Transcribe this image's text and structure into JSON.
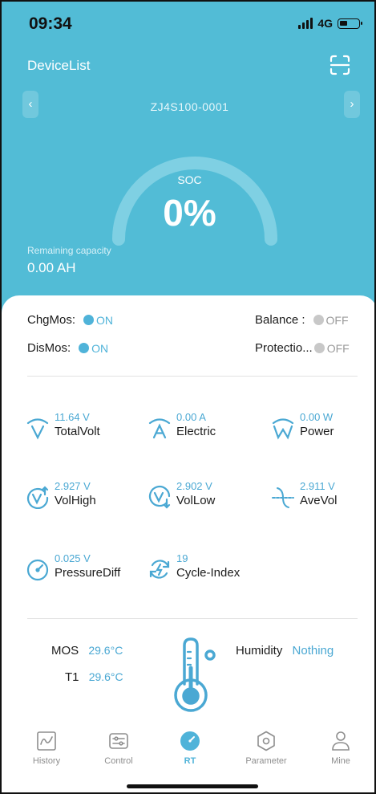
{
  "status_bar": {
    "time": "09:34",
    "network": "4G"
  },
  "header": {
    "title": "DeviceList",
    "device_name": "ZJ4S100-0001",
    "prev_icon": "chevron-left-icon",
    "next_icon": "chevron-right-icon",
    "scan_icon": "scan-icon"
  },
  "soc": {
    "label": "SOC",
    "value": "0%",
    "percent": 0
  },
  "remaining": {
    "label": "Remaining capacity",
    "value": "0.00 AH"
  },
  "switches": {
    "chg_mos": {
      "label": "ChgMos:",
      "state": "ON"
    },
    "dis_mos": {
      "label": "DisMos:",
      "state": "ON"
    },
    "balance": {
      "label": "Balance :",
      "state": "OFF"
    },
    "protection": {
      "label": "Protectio...",
      "state": "OFF"
    }
  },
  "metrics": {
    "total_volt": {
      "value": "11.64 V",
      "label": "TotalVolt",
      "icon": "voltage-icon"
    },
    "electric": {
      "value": "0.00 A",
      "label": "Electric",
      "icon": "current-icon"
    },
    "power": {
      "value": "0.00 W",
      "label": "Power",
      "icon": "power-icon"
    },
    "vol_high": {
      "value": "2.927 V",
      "label": "VolHigh",
      "icon": "voltage-high-icon"
    },
    "vol_low": {
      "value": "2.902 V",
      "label": "VolLow",
      "icon": "voltage-low-icon"
    },
    "ave_vol": {
      "value": "2.911 V",
      "label": "AveVol",
      "icon": "average-voltage-icon"
    },
    "pressure_diff": {
      "value": "0.025 V",
      "label": "PressureDiff",
      "icon": "gauge-icon"
    },
    "cycle_index": {
      "value": "19",
      "label": "Cycle-Index",
      "icon": "cycle-icon"
    }
  },
  "temperature": {
    "mos": {
      "label": "MOS",
      "value": "29.6°C"
    },
    "t1": {
      "label": "T1",
      "value": "29.6°C"
    },
    "humidity": {
      "label": "Humidity",
      "value": "Nothing"
    },
    "icon": "thermometer-icon"
  },
  "tabs": [
    {
      "label": "History",
      "icon": "history-chart-icon"
    },
    {
      "label": "Control",
      "icon": "control-sliders-icon"
    },
    {
      "label": "RT",
      "icon": "realtime-gauge-icon"
    },
    {
      "label": "Parameter",
      "icon": "parameter-hexagon-icon"
    },
    {
      "label": "Mine",
      "icon": "user-icon"
    }
  ],
  "colors": {
    "header_bg": "#52bcd6",
    "accent": "#4fb3d9",
    "value_blue": "#4aa8d3"
  }
}
